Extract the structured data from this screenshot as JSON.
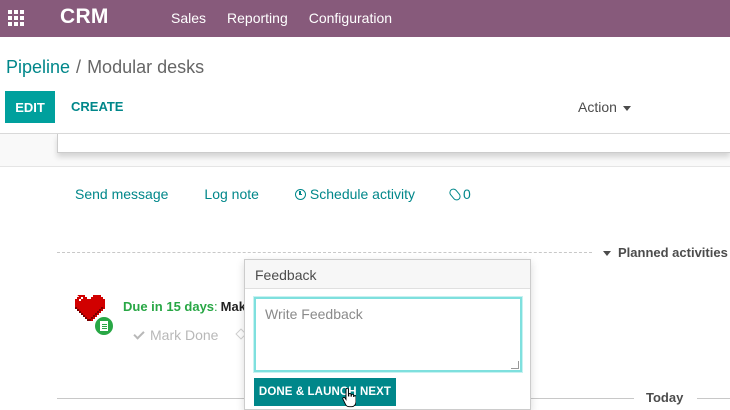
{
  "navbar": {
    "brand": "CRM",
    "menu": [
      "Sales",
      "Reporting",
      "Configuration"
    ],
    "color": "#875a7b"
  },
  "breadcrumb": {
    "parent": "Pipeline",
    "separator": "/",
    "current": "Modular desks"
  },
  "control_panel": {
    "edit_label": "EDIT",
    "create_label": "CREATE",
    "action_label": "Action"
  },
  "chatter": {
    "send_message": "Send message",
    "log_note": "Log note",
    "schedule_activity": "Schedule activity",
    "attachment_count": "0",
    "planned_activities": "Planned activities",
    "today": "Today"
  },
  "activity": {
    "due_label": "Due in 15 days",
    "summary": "Mak",
    "mark_done": "Mark Done",
    "status_color": "#28a745",
    "icon": "heart-icon",
    "type_icon": "document-icon"
  },
  "feedback_popover": {
    "title": "Feedback",
    "placeholder": "Write Feedback",
    "value": "",
    "done_launch_next": "DONE & LAUNCH NEXT"
  },
  "colors": {
    "accent": "#00a09d",
    "link": "#00878a"
  }
}
